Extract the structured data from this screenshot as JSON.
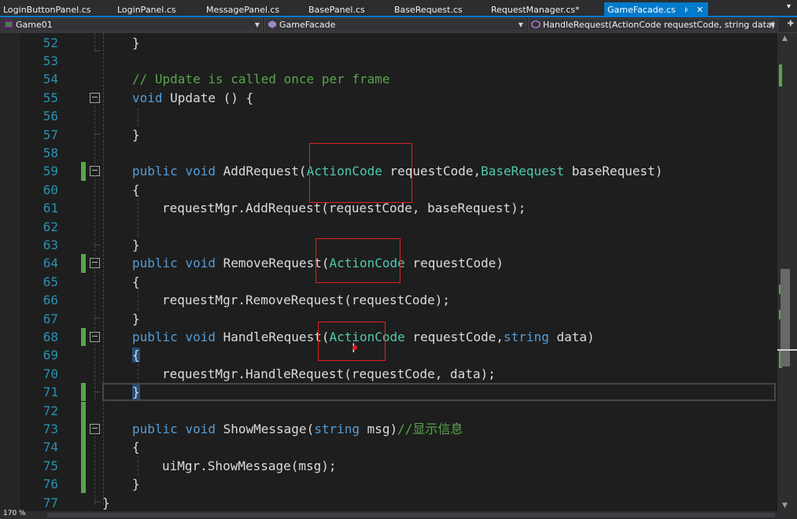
{
  "tabs": [
    {
      "label": "LoginButtonPanel.cs",
      "active": false
    },
    {
      "label": "LoginPanel.cs",
      "active": false
    },
    {
      "label": "MessagePanel.cs",
      "active": false
    },
    {
      "label": "BasePanel.cs",
      "active": false
    },
    {
      "label": "BaseRequest.cs",
      "active": false
    },
    {
      "label": "RequestManager.cs*",
      "active": false
    },
    {
      "label": "GameFacade.cs",
      "active": true
    }
  ],
  "tab_icons": {
    "pin": "⊧",
    "close": "✕",
    "overflow": "▾"
  },
  "navbar": {
    "project": "Game01",
    "class": "GameFacade",
    "member": "HandleRequest(ActionCode requestCode, string data)"
  },
  "editor": {
    "lines": [
      {
        "n": "52",
        "code": [
          [
            "p",
            "}"
          ]
        ]
      },
      {
        "n": "53",
        "code": []
      },
      {
        "n": "54",
        "code": [
          [
            "c",
            "// Update is called once per frame"
          ]
        ]
      },
      {
        "n": "55",
        "code": [
          [
            "k",
            "void"
          ],
          [
            "p",
            " Update () {"
          ]
        ]
      },
      {
        "n": "56",
        "code": []
      },
      {
        "n": "57",
        "code": [
          [
            "p",
            "}"
          ]
        ]
      },
      {
        "n": "58",
        "code": []
      },
      {
        "n": "59",
        "code": [
          [
            "k",
            "public"
          ],
          [
            "p",
            " "
          ],
          [
            "k",
            "void"
          ],
          [
            "p",
            " AddRequest("
          ],
          [
            "t",
            "ActionCode"
          ],
          [
            "p",
            " requestCode,"
          ],
          [
            "t",
            "BaseRequest"
          ],
          [
            "p",
            " baseRequest)"
          ]
        ]
      },
      {
        "n": "60",
        "code": [
          [
            "p",
            "{"
          ]
        ]
      },
      {
        "n": "61",
        "code": [
          [
            "p",
            "requestMgr.AddRequest(requestCode, baseRequest);"
          ]
        ]
      },
      {
        "n": "62",
        "code": []
      },
      {
        "n": "63",
        "code": [
          [
            "p",
            "}"
          ]
        ]
      },
      {
        "n": "64",
        "code": [
          [
            "k",
            "public"
          ],
          [
            "p",
            " "
          ],
          [
            "k",
            "void"
          ],
          [
            "p",
            " RemoveRequest("
          ],
          [
            "t",
            "ActionCode"
          ],
          [
            "p",
            " requestCode)"
          ]
        ]
      },
      {
        "n": "65",
        "code": [
          [
            "p",
            "{"
          ]
        ]
      },
      {
        "n": "66",
        "code": [
          [
            "p",
            "requestMgr.RemoveRequest(requestCode);"
          ]
        ]
      },
      {
        "n": "67",
        "code": [
          [
            "p",
            "}"
          ]
        ]
      },
      {
        "n": "68",
        "code": [
          [
            "k",
            "public"
          ],
          [
            "p",
            " "
          ],
          [
            "k",
            "void"
          ],
          [
            "p",
            " HandleRequest("
          ],
          [
            "t",
            "ActionCode"
          ],
          [
            "p",
            " requestCode,"
          ],
          [
            "k",
            "string"
          ],
          [
            "p",
            " data)"
          ]
        ]
      },
      {
        "n": "69",
        "code": [
          [
            "h",
            "{"
          ]
        ]
      },
      {
        "n": "70",
        "code": [
          [
            "p",
            "requestMgr.HandleRequest(requestCode, data);"
          ]
        ]
      },
      {
        "n": "71",
        "code": [
          [
            "h",
            "}"
          ]
        ]
      },
      {
        "n": "72",
        "code": []
      },
      {
        "n": "73",
        "code": [
          [
            "k",
            "public"
          ],
          [
            "p",
            " "
          ],
          [
            "k",
            "void"
          ],
          [
            "p",
            " ShowMessage("
          ],
          [
            "k",
            "string"
          ],
          [
            "p",
            " msg)"
          ],
          [
            "c",
            "//显示信息"
          ]
        ]
      },
      {
        "n": "74",
        "code": [
          [
            "p",
            "{"
          ]
        ]
      },
      {
        "n": "75",
        "code": [
          [
            "p",
            "uiMgr.ShowMessage(msg);"
          ]
        ]
      },
      {
        "n": "76",
        "code": [
          [
            "p",
            "}"
          ]
        ]
      },
      {
        "n": "77",
        "code": [
          [
            "p",
            "}"
          ]
        ]
      }
    ],
    "current_line": "71",
    "changed_lines": [
      "59",
      "64",
      "68",
      "71",
      "72",
      "73",
      "74",
      "75",
      "76"
    ],
    "foldable_lines": [
      "55",
      "59",
      "64",
      "68",
      "73"
    ],
    "colors": {
      "keyword": "#569cd6",
      "type": "#4ec9b0",
      "comment": "#57a64a",
      "plain": "#dcdcdc",
      "line_number": "#2b91af",
      "accent": "#007acc",
      "highlight_box": "#e02020"
    }
  },
  "statusbar": {
    "zoom": "170 %"
  }
}
